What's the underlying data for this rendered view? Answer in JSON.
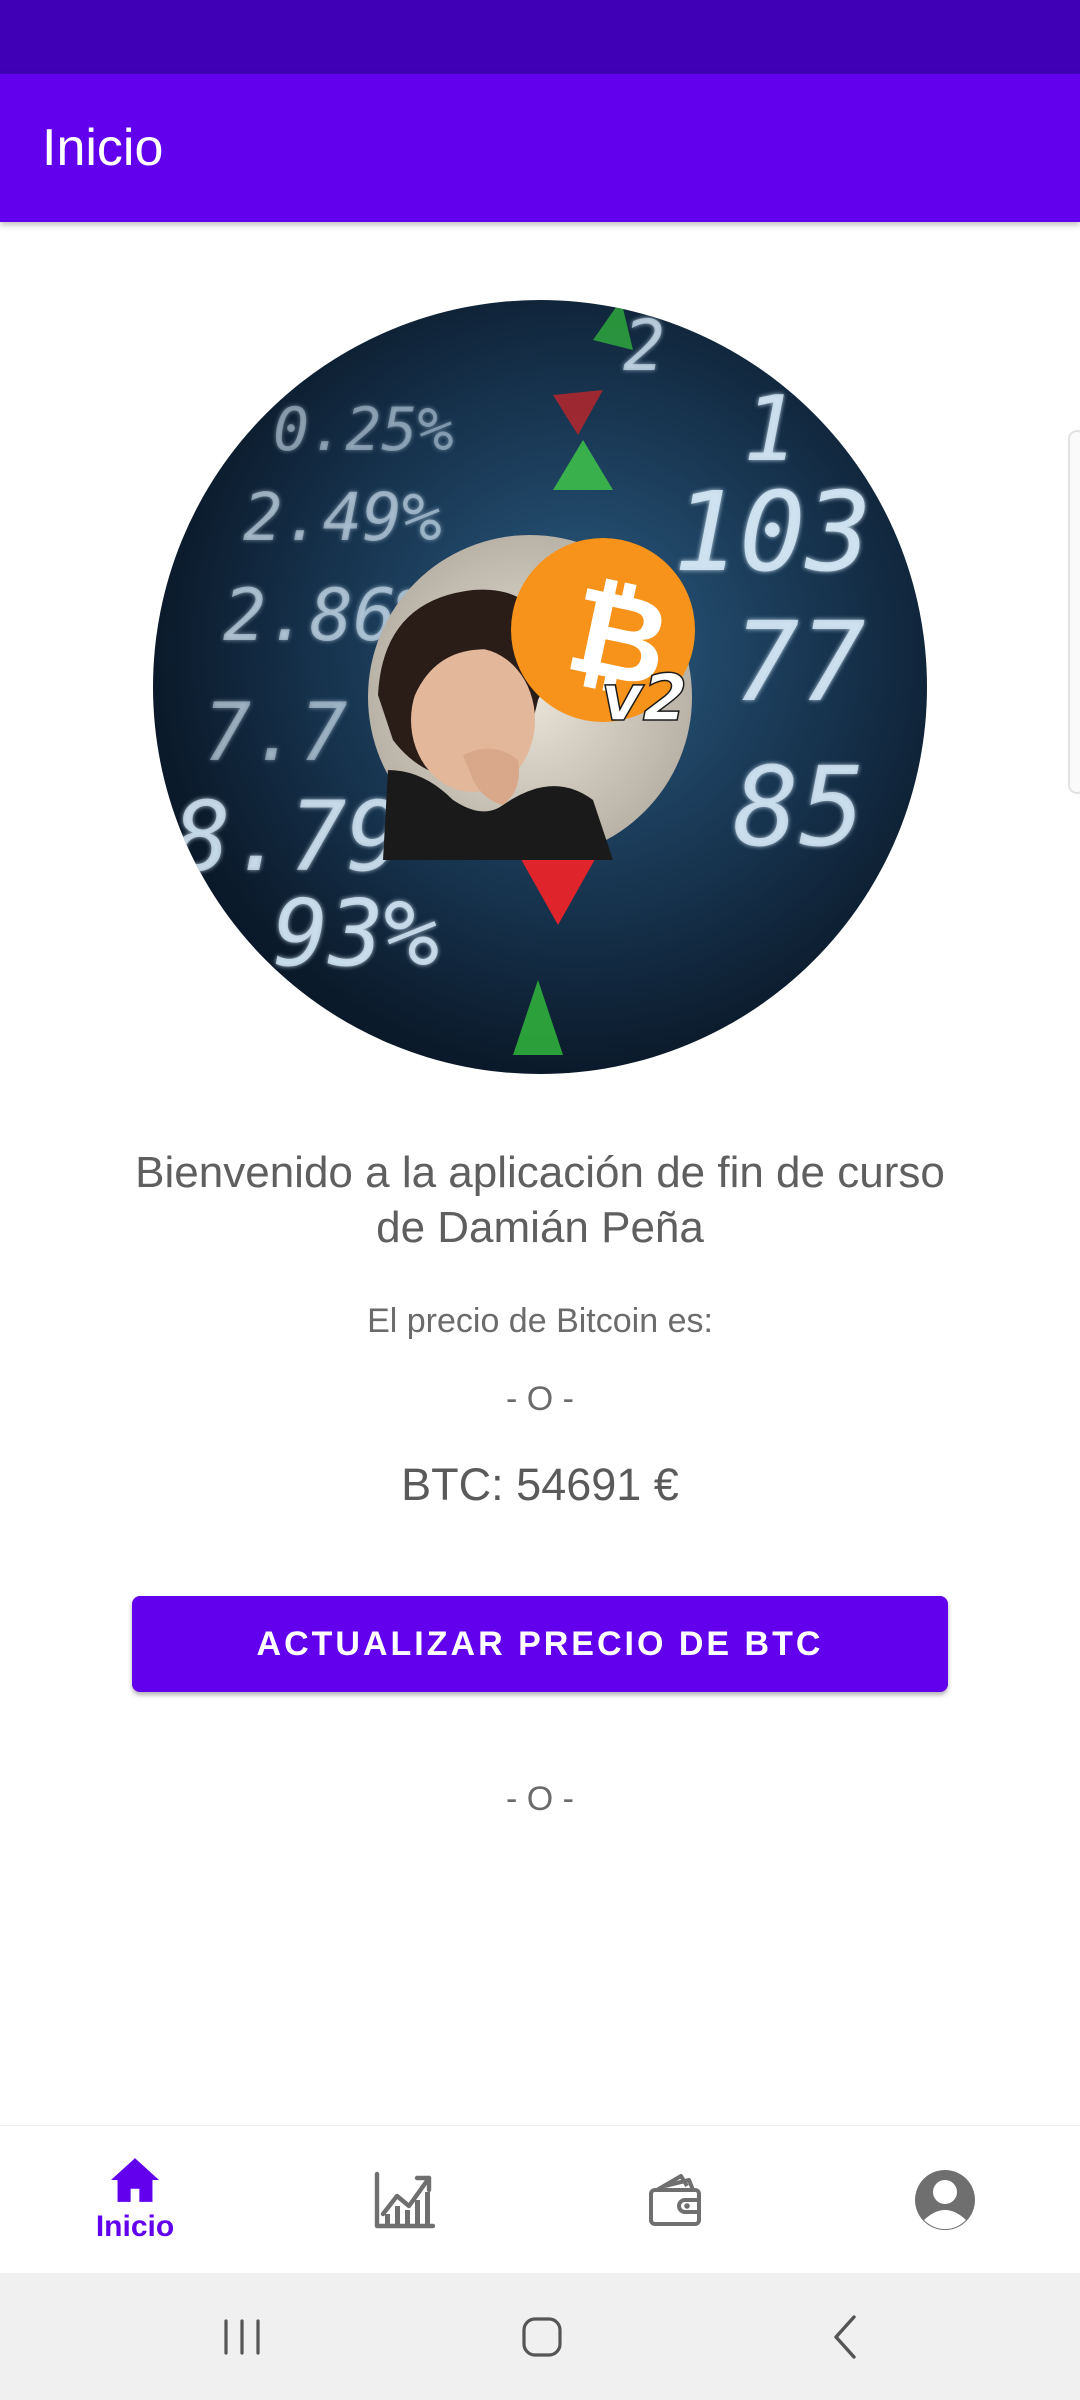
{
  "app_bar": {
    "title": "Inicio"
  },
  "main": {
    "welcome_text": "Bienvenido a la aplicación de fin de curso de Damián Peña",
    "price_label": "El precio de Bitcoin es:",
    "separator_top": "- O -",
    "btc_price": "BTC: 54691 €",
    "update_button_label": "ACTUALIZAR PRECIO DE BTC",
    "separator_bottom": "- O -"
  },
  "hero": {
    "ticker_numbers": [
      "2",
      "1",
      "0.25%",
      "2.49%",
      "103",
      "2.86%",
      "77",
      "7.7",
      "8.79",
      "85",
      "93%"
    ],
    "badge_text": "v2",
    "badge_symbol": "₿"
  },
  "bottom_nav": {
    "items": [
      {
        "label": "Inicio",
        "icon": "home-icon",
        "active": true
      },
      {
        "label": "",
        "icon": "chart-icon",
        "active": false
      },
      {
        "label": "",
        "icon": "wallet-icon",
        "active": false
      },
      {
        "label": "",
        "icon": "account-icon",
        "active": false
      }
    ]
  },
  "system_nav": {
    "icons": [
      "recent-apps-icon",
      "home-circle-icon",
      "back-icon"
    ]
  },
  "colors": {
    "status_bar": "#3f00b6",
    "primary": "#6200ee",
    "text_gray": "#5f5f5f",
    "bitcoin_orange": "#f7931a"
  }
}
